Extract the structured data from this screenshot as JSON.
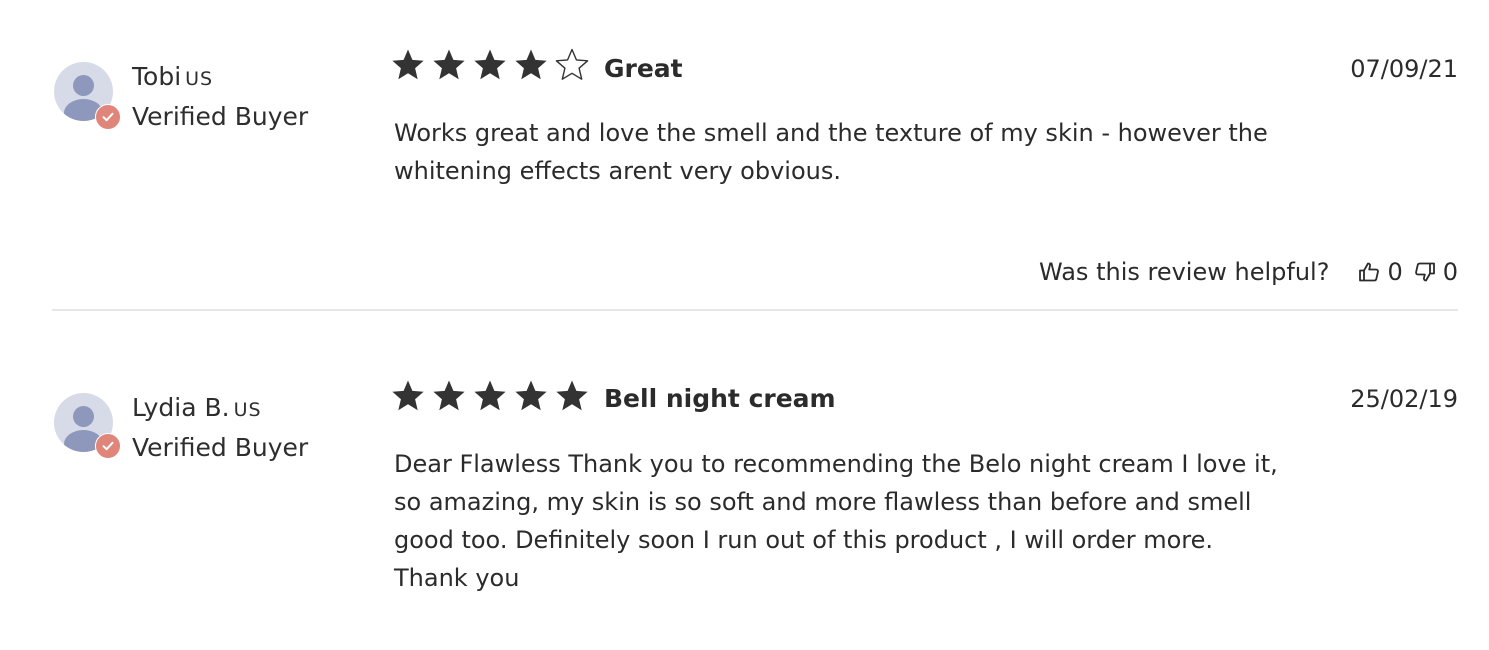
{
  "reviews": [
    {
      "author": "Tobi",
      "country": "US",
      "buyer_status": "Verified Buyer",
      "rating": 4,
      "max_rating": 5,
      "title": "Great",
      "date": "07/09/21",
      "body": "Works great and love the smell and the texture of my skin - however the whitening effects arent very obvious.",
      "helpful_question": "Was this review helpful?",
      "thumbs_up_count": "0",
      "thumbs_down_count": "0"
    },
    {
      "author": "Lydia B.",
      "country": "US",
      "buyer_status": "Verified Buyer",
      "rating": 5,
      "max_rating": 5,
      "title": "Bell night cream",
      "date": "25/02/19",
      "body": "Dear Flawless Thank you to recommending the Belo night cream I love it, so amazing, my skin is so soft and more flawless than before and smell good too. Definitely soon I run out of this product , I will order more. Thank you"
    }
  ],
  "colors": {
    "star": "#333333",
    "badge": "#e0857a",
    "avatar_bg": "#d7dbe8",
    "avatar_fg": "#8e98bc",
    "divider": "#e7e7e7"
  },
  "icons": {
    "avatar": "user-avatar-icon",
    "badge": "verified-check-icon",
    "star_filled": "star-filled-icon",
    "star_empty": "star-outline-icon",
    "thumbs_up": "thumbs-up-icon",
    "thumbs_down": "thumbs-down-icon"
  }
}
